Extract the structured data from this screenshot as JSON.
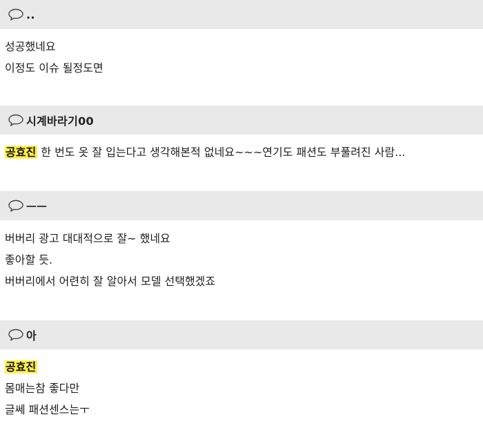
{
  "comments": [
    {
      "nickname": "..",
      "lines": [
        {
          "text": "성공했네요"
        },
        {
          "text": "이정도 이슈 될정도면"
        }
      ]
    },
    {
      "nickname": "시계바라기00",
      "lines": [
        {
          "highlight": "공효진",
          "text": " 한 번도 옷 잘 입는다고 생각해본적 없네요~~~연기도 패션도 부풀려진 사람..."
        }
      ]
    },
    {
      "nickname": "ㅡㅡ",
      "lines": [
        {
          "text": "버버리 광고 대대적으로 잘~ 했네요"
        },
        {
          "text": "좋아할 듯."
        },
        {
          "text": "버버리에서 어련히 잘 알아서 모델 선택했겠죠"
        }
      ]
    },
    {
      "nickname": "아",
      "lines": [
        {
          "highlight": "공효진",
          "text": ""
        },
        {
          "text": "몸매는참 좋다만"
        },
        {
          "text": "글쎄 패션센스는ㅜ"
        }
      ]
    }
  ],
  "icons": {
    "comment_icon": "speech-bubble-icon"
  },
  "colors": {
    "header_background": "#e9e9e9",
    "highlight": "#fff04a"
  }
}
